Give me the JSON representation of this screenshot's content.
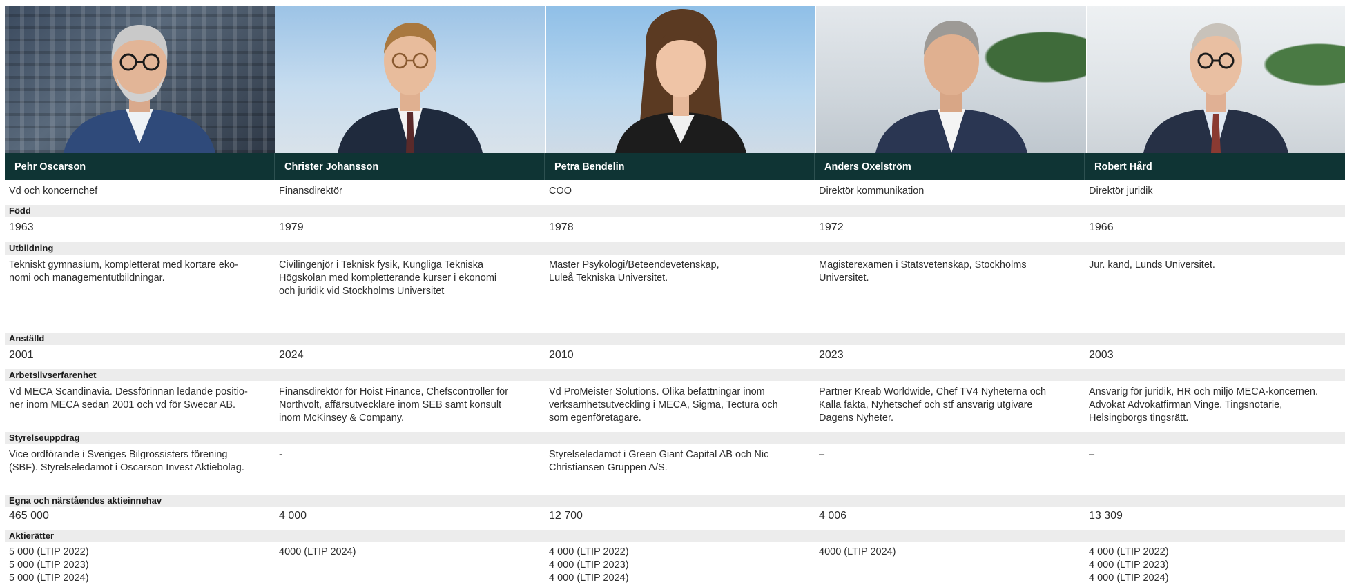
{
  "people": [
    {
      "name": "Pehr Oscarson",
      "title": "Vd och koncernchef",
      "born": "1963",
      "education": "Tekniskt gymnasium, kompletterat med kortare eko-\nnomi och managementutbildningar.",
      "employed": "2001",
      "experience": "Vd MECA Scandinavia. Dessförinnan ledande positio-\nner inom MECA sedan 2001 och vd för Swecar AB.",
      "board": "Vice ordförande i Sveriges Bilgrossisters förening\n(SBF). Styrelseledamot i Oscarson Invest Aktiebolag.",
      "shares": "465 000",
      "rights": "5 000 (LTIP 2022)\n5 000 (LTIP 2023)\n5 000 (LTIP 2024)"
    },
    {
      "name": "Christer Johansson",
      "title": "Finansdirektör",
      "born": "1979",
      "education": "Civilingenjör i Teknisk fysik, Kungliga Tekniska\nHögskolan med kompletterande kurser i ekonomi\noch juridik vid Stockholms Universitet",
      "employed": "2024",
      "experience": " Finansdirektör för Hoist Finance, Chefscontroller för\nNorthvolt, affärsutvecklare inom SEB samt konsult\ninom McKinsey & Company.",
      "board": "-",
      "shares": "4 000",
      "rights": "4000 (LTIP 2024)"
    },
    {
      "name": "Petra Bendelin",
      "title": "COO",
      "born": "1978",
      "education": "Master Psykologi/Beteendevetenskap,\nLuleå Tekniska Universitet.",
      "employed": "2010",
      "experience": "Vd ProMeister Solutions. Olika befattningar inom\nverksamhetsutveckling i MECA, Sigma, Tectura och\nsom egenföretagare.",
      "board": "Styrelseledamot i Green Giant Capital AB och Nic\nChristiansen Gruppen A/S.",
      "shares": "12 700",
      "rights": "4 000 (LTIP 2022)\n4 000 (LTIP 2023)\n4 000 (LTIP 2024)"
    },
    {
      "name": "Anders Oxelström",
      "title": "Direktör kommunikation",
      "born": "1972",
      "education": "Magisterexamen i Statsvetenskap, Stockholms\nUniversitet.",
      "employed": "2023",
      "experience": "Partner Kreab Worldwide, Chef TV4 Nyheterna och\nKalla fakta, Nyhetschef och stf ansvarig utgivare\nDagens Nyheter.",
      "board": "–",
      "shares": "4 006",
      "rights": "4000 (LTIP 2024)"
    },
    {
      "name": "Robert Hård",
      "title": "Direktör juridik",
      "born": "1966",
      "education": "Jur. kand, Lunds Universitet.",
      "employed": "2003",
      "experience": "Ansvarig för juridik, HR och miljö MECA-koncernen.\nAdvokat Advokatfirman Vinge. Tingsnotarie,\nHelsingborgs tingsrätt.",
      "board": "–",
      "shares": "13 309",
      "rights": "4 000 (LTIP 2022)\n4 000 (LTIP 2023)\n4 000 (LTIP 2024)"
    }
  ],
  "labels": {
    "born": "Född",
    "education": "Utbildning",
    "employed": "Anställd",
    "experience": "Arbetslivserfarenhet",
    "board": "Styrelseuppdrag",
    "shares": "Egna och närståendes aktieinnehav",
    "rights": "Aktierätter"
  },
  "colors": {
    "name_bar": "#0f3434",
    "label_bg": "#ececec"
  }
}
